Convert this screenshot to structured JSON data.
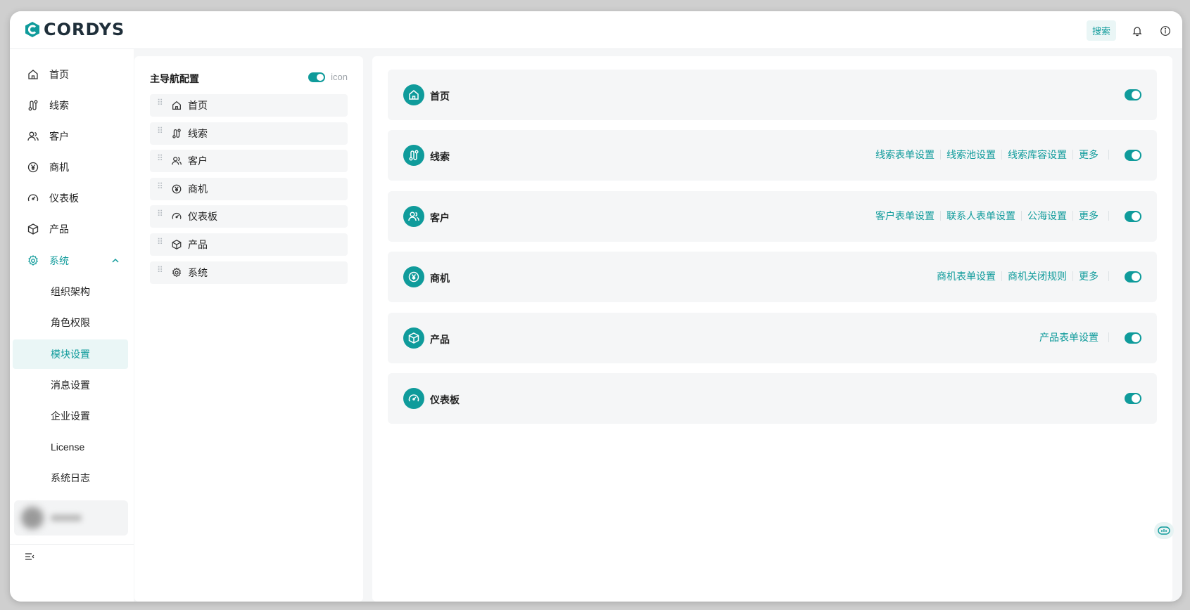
{
  "app": {
    "logo_text": "CORDYS"
  },
  "header": {
    "search_label": "搜索",
    "icons": [
      "bell-icon",
      "info-icon"
    ]
  },
  "colors": {
    "accent": "#0f9b9b",
    "accent_light": "#eaf6f6",
    "card_bg": "#f5f6f7"
  },
  "sidebar": {
    "items": [
      {
        "label": "首页",
        "icon": "home-icon"
      },
      {
        "label": "线索",
        "icon": "route-icon"
      },
      {
        "label": "客户",
        "icon": "users-icon"
      },
      {
        "label": "商机",
        "icon": "yen-icon"
      },
      {
        "label": "仪表板",
        "icon": "gauge-icon"
      },
      {
        "label": "产品",
        "icon": "box-icon"
      },
      {
        "label": "系统",
        "icon": "gear-icon",
        "expanded": true
      }
    ],
    "sub_items": [
      {
        "label": "组织架构"
      },
      {
        "label": "角色权限"
      },
      {
        "label": "模块设置",
        "active": true
      },
      {
        "label": "消息设置"
      },
      {
        "label": "企业设置"
      },
      {
        "label": "License"
      },
      {
        "label": "系统日志"
      }
    ]
  },
  "nav_config": {
    "title": "主导航配置",
    "icon_toggle_label": "icon",
    "icon_toggle_on": true,
    "items": [
      {
        "label": "首页",
        "icon": "home-icon"
      },
      {
        "label": "线索",
        "icon": "route-icon"
      },
      {
        "label": "客户",
        "icon": "users-icon"
      },
      {
        "label": "商机",
        "icon": "yen-icon"
      },
      {
        "label": "仪表板",
        "icon": "gauge-icon"
      },
      {
        "label": "产品",
        "icon": "box-icon"
      },
      {
        "label": "系统",
        "icon": "gear-icon"
      }
    ]
  },
  "modules": [
    {
      "title": "首页",
      "icon": "home-icon",
      "links": [],
      "enabled": true
    },
    {
      "title": "线索",
      "icon": "route-icon",
      "links": [
        "线索表单设置",
        "线索池设置",
        "线索库容设置",
        "更多"
      ],
      "enabled": true
    },
    {
      "title": "客户",
      "icon": "users-icon",
      "links": [
        "客户表单设置",
        "联系人表单设置",
        "公海设置",
        "更多"
      ],
      "enabled": true
    },
    {
      "title": "商机",
      "icon": "yen-icon",
      "links": [
        "商机表单设置",
        "商机关闭规则",
        "更多"
      ],
      "enabled": true
    },
    {
      "title": "产品",
      "icon": "box-icon",
      "links": [
        "产品表单设置"
      ],
      "enabled": true
    },
    {
      "title": "仪表板",
      "icon": "gauge-icon",
      "links": [],
      "enabled": true
    }
  ]
}
